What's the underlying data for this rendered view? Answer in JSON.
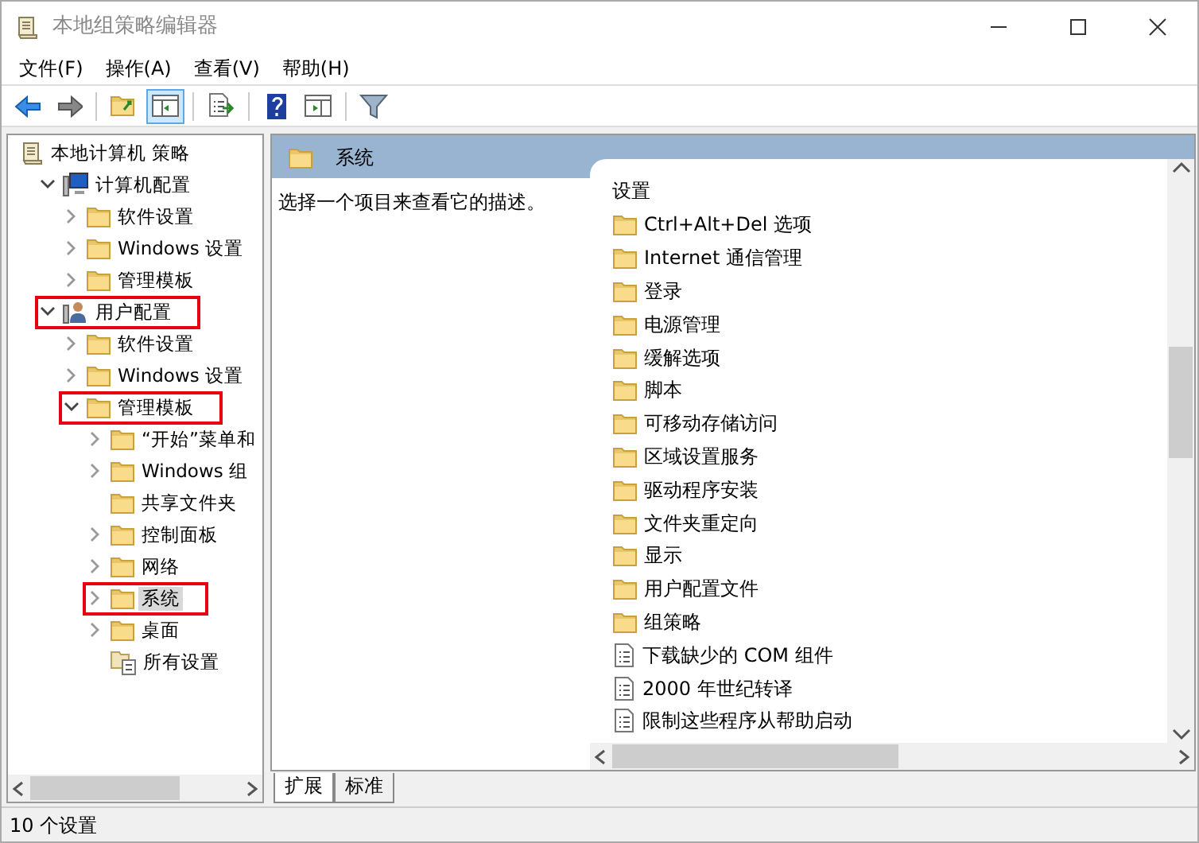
{
  "window": {
    "title": "本地组策略编辑器"
  },
  "menu": [
    "文件(F)",
    "操作(A)",
    "查看(V)",
    "帮助(H)"
  ],
  "toolbar": [
    {
      "kind": "back",
      "pressed": false
    },
    {
      "kind": "forward",
      "pressed": false
    },
    {
      "kind": "sep"
    },
    {
      "kind": "up",
      "pressed": false
    },
    {
      "kind": "tree",
      "pressed": true
    },
    {
      "kind": "sep"
    },
    {
      "kind": "export",
      "pressed": false
    },
    {
      "kind": "sep"
    },
    {
      "kind": "help",
      "pressed": false
    },
    {
      "kind": "pane",
      "pressed": false
    },
    {
      "kind": "sep"
    },
    {
      "kind": "filter",
      "pressed": false
    }
  ],
  "tree": [
    {
      "label": "本地计算机 策略",
      "kind": "policy",
      "selected": false,
      "highlighted": false,
      "children": [
        {
          "label": "计算机配置",
          "kind": "computer",
          "expandable": true,
          "expanded": true,
          "selected": false,
          "highlighted": false,
          "children": [
            {
              "label": "软件设置",
              "kind": "folder",
              "expandable": true,
              "expanded": false,
              "selected": false,
              "highlighted": false
            },
            {
              "label": "Windows 设置",
              "kind": "folder",
              "expandable": true,
              "expanded": false,
              "selected": false,
              "highlighted": false
            },
            {
              "label": "管理模板",
              "kind": "folder",
              "expandable": true,
              "expanded": false,
              "selected": false,
              "highlighted": false
            }
          ]
        },
        {
          "label": "用户配置",
          "kind": "user",
          "expandable": true,
          "expanded": true,
          "selected": false,
          "highlighted": true,
          "children": [
            {
              "label": "软件设置",
              "kind": "folder",
              "expandable": true,
              "expanded": false,
              "selected": false,
              "highlighted": false
            },
            {
              "label": "Windows 设置",
              "kind": "folder",
              "expandable": true,
              "expanded": false,
              "selected": false,
              "highlighted": false
            },
            {
              "label": "管理模板",
              "kind": "folder",
              "expandable": true,
              "expanded": true,
              "selected": false,
              "highlighted": true,
              "children": [
                {
                  "label": "“开始”菜单和",
                  "kind": "folder",
                  "expandable": true,
                  "expanded": false,
                  "selected": false,
                  "highlighted": false
                },
                {
                  "label": "Windows 组",
                  "kind": "folder",
                  "expandable": true,
                  "expanded": false,
                  "selected": false,
                  "highlighted": false
                },
                {
                  "label": "共享文件夹",
                  "kind": "folder",
                  "selected": false,
                  "highlighted": false
                },
                {
                  "label": "控制面板",
                  "kind": "folder",
                  "expandable": true,
                  "expanded": false,
                  "selected": false,
                  "highlighted": false
                },
                {
                  "label": "网络",
                  "kind": "folder",
                  "expandable": true,
                  "expanded": false,
                  "selected": false,
                  "highlighted": false
                },
                {
                  "label": "系统",
                  "kind": "folder",
                  "expandable": true,
                  "expanded": false,
                  "selected": true,
                  "highlighted": true
                },
                {
                  "label": "桌面",
                  "kind": "folder",
                  "expandable": true,
                  "expanded": false,
                  "selected": false,
                  "highlighted": false
                },
                {
                  "label": "所有设置",
                  "kind": "allsettings",
                  "selected": false,
                  "highlighted": false
                }
              ]
            }
          ]
        }
      ]
    }
  ],
  "details": {
    "title": "系统",
    "description": "选择一个项目来查看它的描述。",
    "column": "设置",
    "items": [
      {
        "label": "Ctrl+Alt+Del 选项",
        "kind": "folder"
      },
      {
        "label": "Internet 通信管理",
        "kind": "folder"
      },
      {
        "label": "登录",
        "kind": "folder"
      },
      {
        "label": "电源管理",
        "kind": "folder"
      },
      {
        "label": "缓解选项",
        "kind": "folder"
      },
      {
        "label": "脚本",
        "kind": "folder"
      },
      {
        "label": "可移动存储访问",
        "kind": "folder"
      },
      {
        "label": "区域设置服务",
        "kind": "folder"
      },
      {
        "label": "驱动程序安装",
        "kind": "folder"
      },
      {
        "label": "文件夹重定向",
        "kind": "folder"
      },
      {
        "label": "显示",
        "kind": "folder"
      },
      {
        "label": "用户配置文件",
        "kind": "folder"
      },
      {
        "label": "组策略",
        "kind": "folder"
      },
      {
        "label": "下载缺少的 COM 组件",
        "kind": "setting"
      },
      {
        "label": "2000 年世纪转译",
        "kind": "setting"
      },
      {
        "label": "限制这些程序从帮助启动",
        "kind": "setting"
      }
    ]
  },
  "tabs": [
    {
      "label": "扩展",
      "selected": true
    },
    {
      "label": "标准",
      "selected": false
    }
  ],
  "status_bar": "10 个设置"
}
